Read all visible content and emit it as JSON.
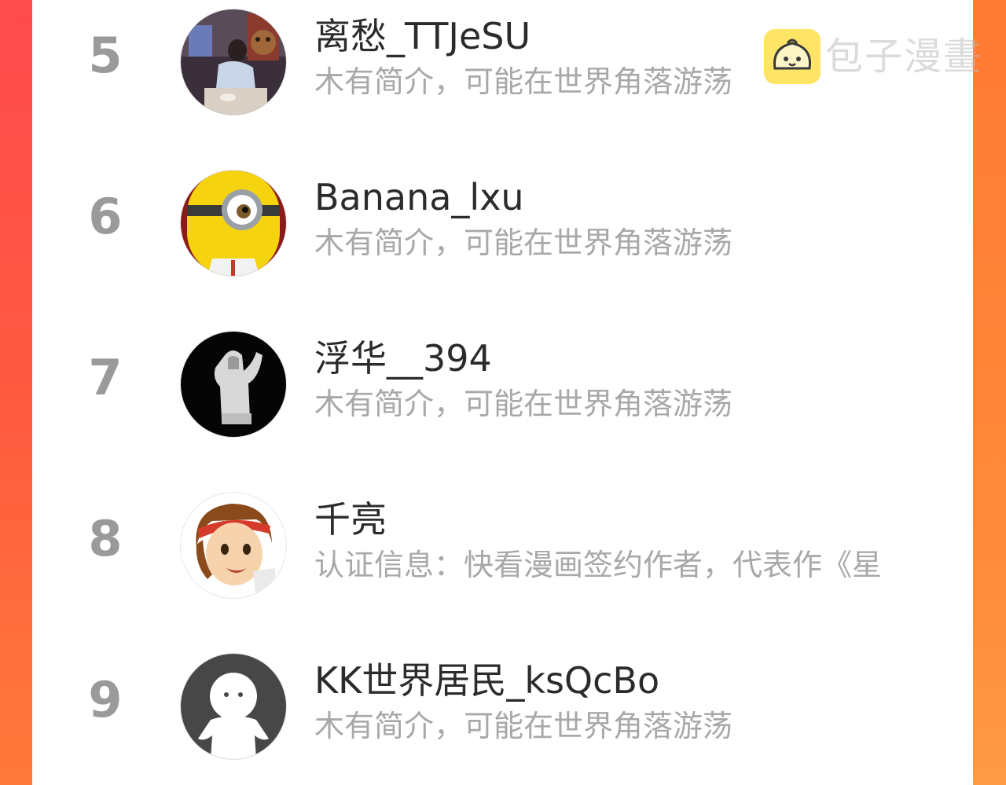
{
  "watermark": {
    "text": "包子漫畫",
    "logo_color": "#ffe566"
  },
  "accent_colors": {
    "background_left": "#ff4a4e",
    "background_right": "#ff8a3a",
    "card": "#ffffff",
    "rank_number": "#9a9a9a",
    "name_text": "#2b2b2b",
    "description_text": "#a8a8a8"
  },
  "ranking": {
    "rows": [
      {
        "rank": "5",
        "name": "离愁_TTJeSU",
        "description": "木有简介，可能在世界角落游荡",
        "avatar_icon": "photo-avatar-person-at-table"
      },
      {
        "rank": "6",
        "name": "Banana_lxu",
        "description": "木有简介，可能在世界角落游荡",
        "avatar_icon": "minion-avatar"
      },
      {
        "rank": "7",
        "name": "浮华__394",
        "description": "木有简介，可能在世界角落游荡",
        "avatar_icon": "silhouette-hoodie-avatar"
      },
      {
        "rank": "8",
        "name": "千亮",
        "description": "认证信息：快看漫画签约作者，代表作《星",
        "avatar_icon": "manga-boy-headband-avatar"
      },
      {
        "rank": "9",
        "name": "KK世界居民_ksQcBo",
        "description": "木有简介，可能在世界角落游荡",
        "avatar_icon": "default-user-avatar"
      }
    ]
  }
}
